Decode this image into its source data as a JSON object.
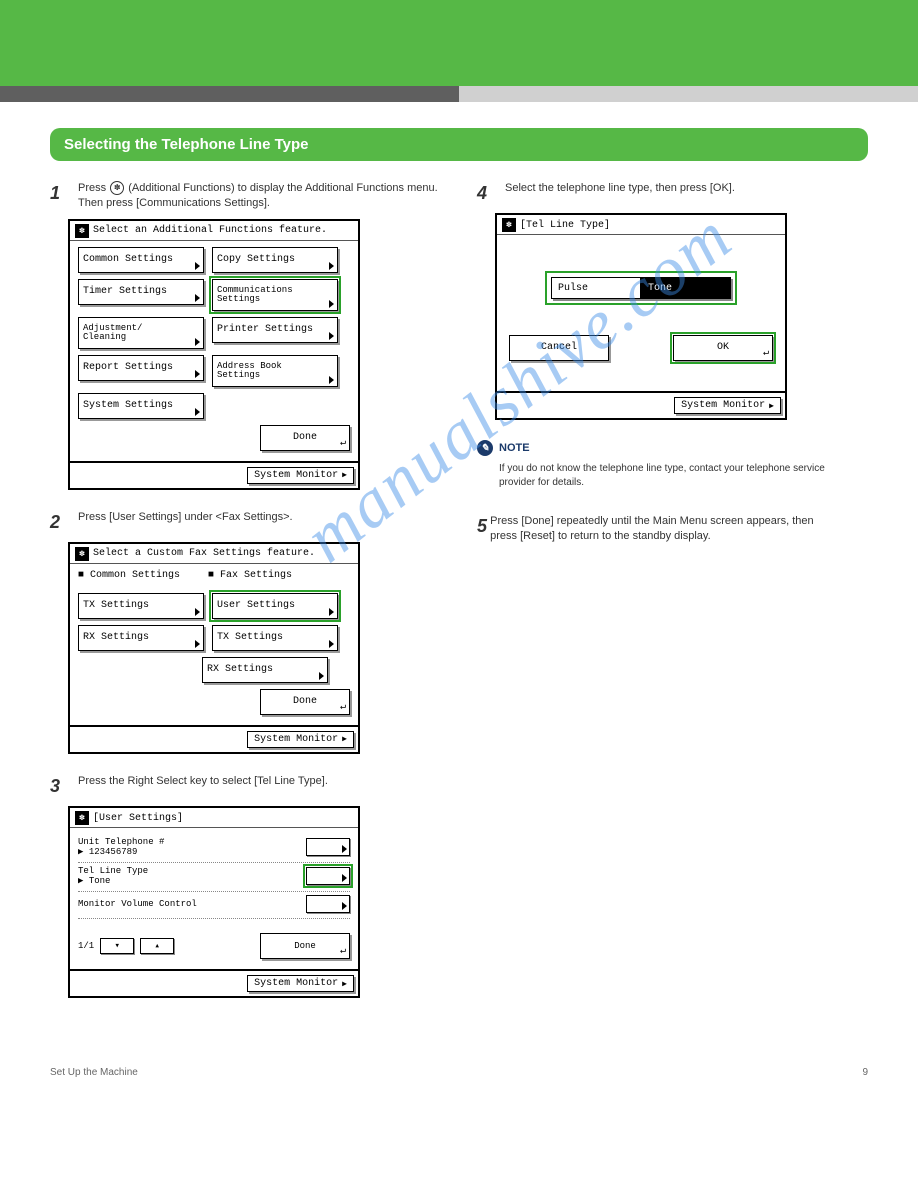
{
  "page": {
    "section_title": "Selecting the Telephone Line Type",
    "footer_left": "Set Up the Machine",
    "footer_right": "9",
    "watermark": "manualshive.com"
  },
  "left": {
    "step1": {
      "num": "1",
      "text_a": "Press ",
      "text_b": " (Additional Functions) to display the Additional Functions menu. Then press [Communications Settings]."
    },
    "step2": {
      "num": "2",
      "text": "Press [User Settings] under <Fax Settings>."
    },
    "step3": {
      "num": "3",
      "text": "Press the Right Select key to select [Tel Line Type]."
    }
  },
  "right": {
    "step4": {
      "num": "4",
      "text": "Select the telephone line type, then press [OK]."
    },
    "note_label": "NOTE",
    "note_text": "If you do not know the telephone line type, contact your telephone service provider for details.",
    "reset_num": "5",
    "reset_text": "Press [Done] repeatedly until the Main Menu screen appears, then press [Reset] to return to the standby display."
  },
  "lcd1": {
    "title": "Select an Additional Functions feature.",
    "btn_common": "Common Settings",
    "btn_copy": "Copy Settings",
    "btn_timer": "Timer Settings",
    "btn_comm": "Communications\nSettings",
    "btn_adj": "Adjustment/\nCleaning",
    "btn_printer": "Printer Settings",
    "btn_report": "Report Settings",
    "btn_addr": "Address Book\nSettings",
    "btn_system": "System Settings",
    "done": "Done",
    "sysmon": "System Monitor"
  },
  "lcd2": {
    "title": "Select a Custom Fax Settings feature.",
    "col_a": "Common Settings",
    "col_b": "Fax Settings",
    "a_tx": "TX Settings",
    "a_rx": "RX Settings",
    "b_user": "User Settings",
    "b_tx": "TX Settings",
    "b_rx": "RX Settings",
    "done": "Done",
    "sysmon": "System Monitor"
  },
  "lcd3": {
    "title": "[User Settings]",
    "row1_a": "Unit Telephone #",
    "row1_b": "▶ 123456789",
    "row2_a": "Tel Line Type",
    "row2_b": "▶ Tone",
    "row3_a": "Monitor Volume Control",
    "pager": "1/1",
    "done": "Done",
    "sysmon": "System Monitor"
  },
  "lcd4": {
    "title": "[Tel Line Type]",
    "pulse": "Pulse",
    "tone": "Tone",
    "cancel": "Cancel",
    "ok": "OK",
    "sysmon": "System Monitor"
  }
}
